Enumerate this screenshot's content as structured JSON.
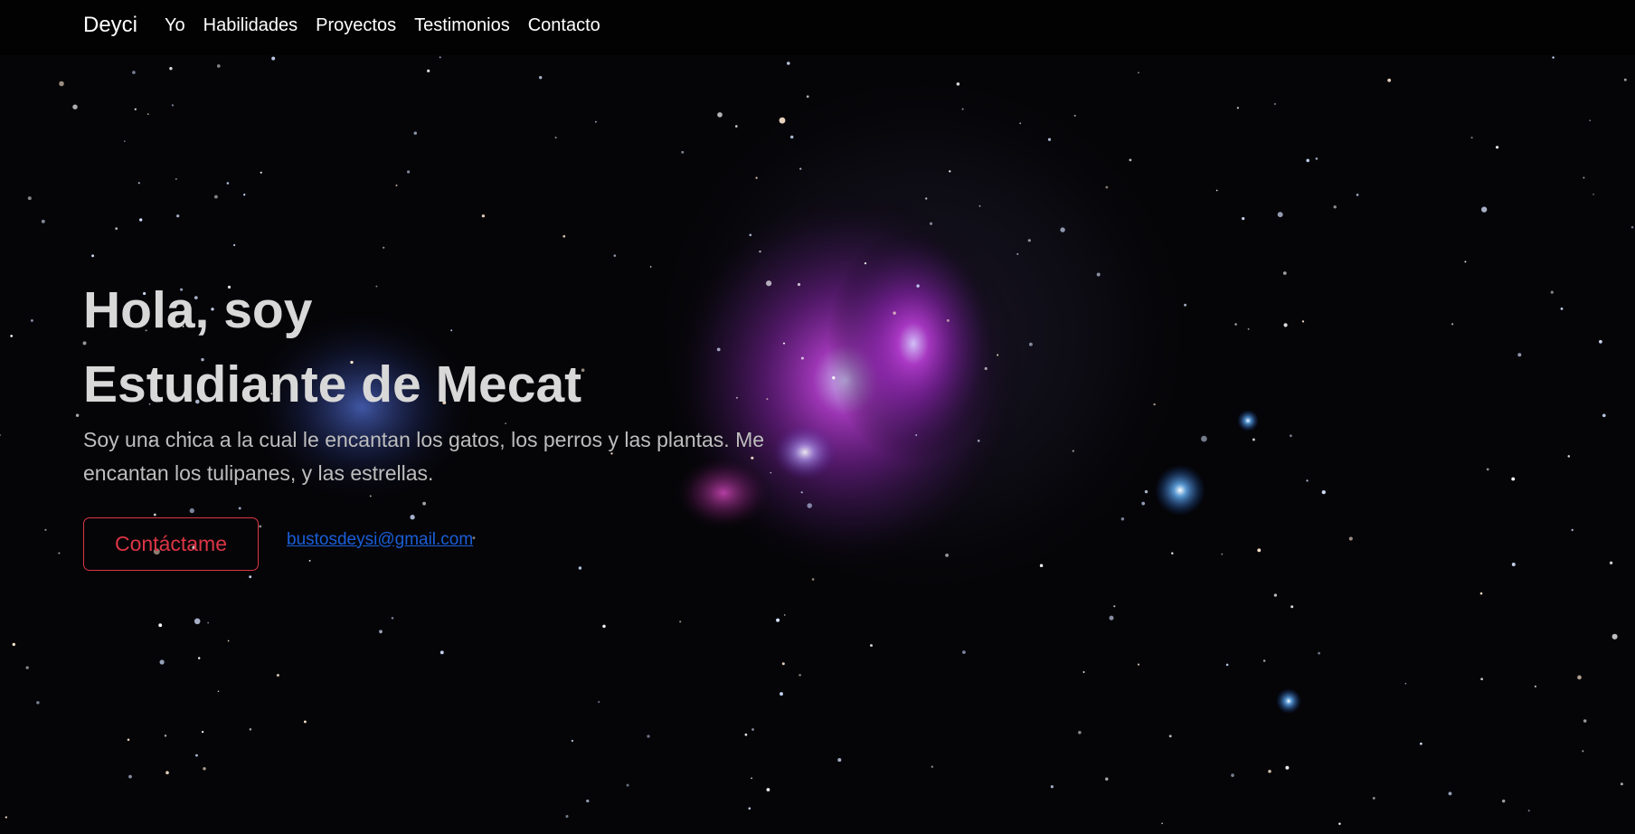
{
  "navbar": {
    "brand": "Deyci",
    "links": [
      "Yo",
      "Habilidades",
      "Proyectos",
      "Testimonios",
      "Contacto"
    ]
  },
  "hero": {
    "title_line1": "Hola, soy",
    "title_line2": "Estudiante de Mecat",
    "description": "Soy una chica a la cual le encantan los gatos, los perros y las plantas. Me encantan los tulipanes, y las estrellas.",
    "contact_button": "Contáctame",
    "email": "bustosdeysi@gmail.com"
  },
  "colors": {
    "navbar_bg": "#020202",
    "button_accent": "#dc3545",
    "link_color": "#1a5ed8",
    "nebula": "#c02ad0"
  }
}
